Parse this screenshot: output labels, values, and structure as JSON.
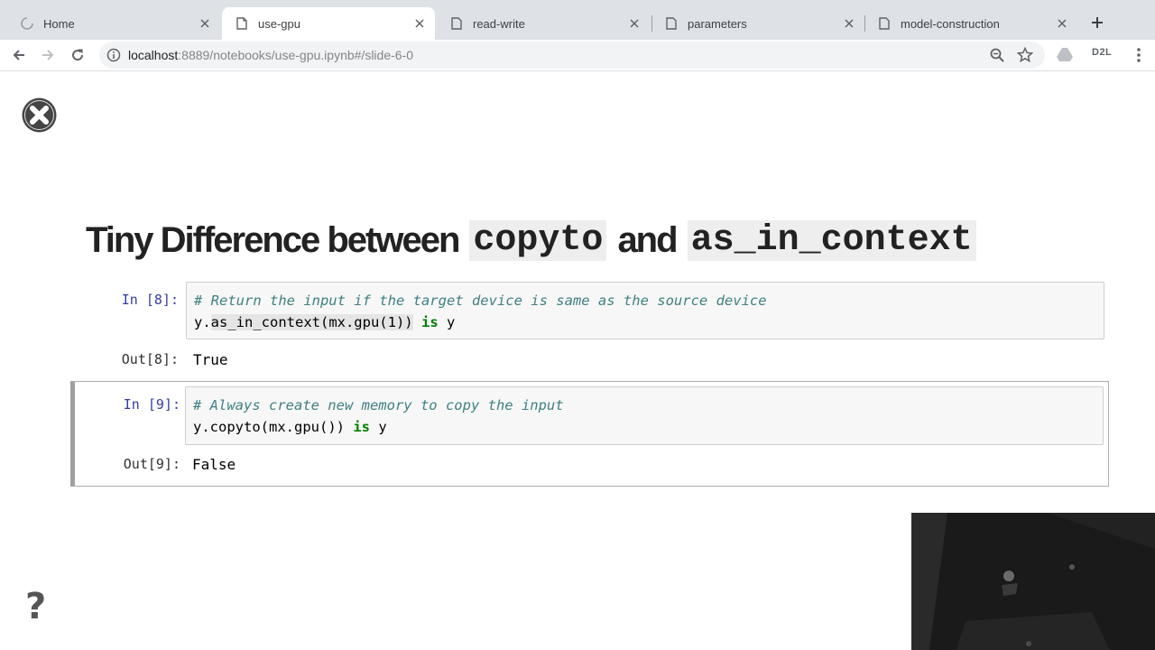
{
  "browser": {
    "tabs": [
      {
        "title": "Home",
        "active": false
      },
      {
        "title": "use-gpu",
        "active": true
      },
      {
        "title": "read-write",
        "active": false
      },
      {
        "title": "parameters",
        "active": false
      },
      {
        "title": "model-construction",
        "active": false
      }
    ],
    "url_host": "localhost",
    "url_rest": ":8889/notebooks/use-gpu.ipynb#/slide-6-0",
    "extension_label": "D2L"
  },
  "slide": {
    "title_part1": "Tiny Difference between",
    "title_code1": "copyto",
    "title_part2": "and",
    "title_code2": "as_in_context",
    "help_glyph": "?"
  },
  "cells": [
    {
      "in_prompt": "In [8]:",
      "comment": "# Return the input if the target device is same as the source device",
      "code_obj": "y.",
      "code_call": "as_in_context(mx.gpu(1))",
      "code_kw": "is",
      "code_tail": "y",
      "out_prompt": "Out[8]:",
      "output": "True"
    },
    {
      "in_prompt": "In [9]:",
      "comment": "# Always create new memory to copy the input",
      "code_obj": "y.",
      "code_call": "copyto(mx.gpu())",
      "code_kw": "is",
      "code_tail": "y",
      "out_prompt": "Out[9]:",
      "output": "False"
    }
  ],
  "colors": {
    "tab_strip": "#dee1e6",
    "prompt_in": "#303f9f",
    "comment": "#408080",
    "keyword": "#008000"
  }
}
